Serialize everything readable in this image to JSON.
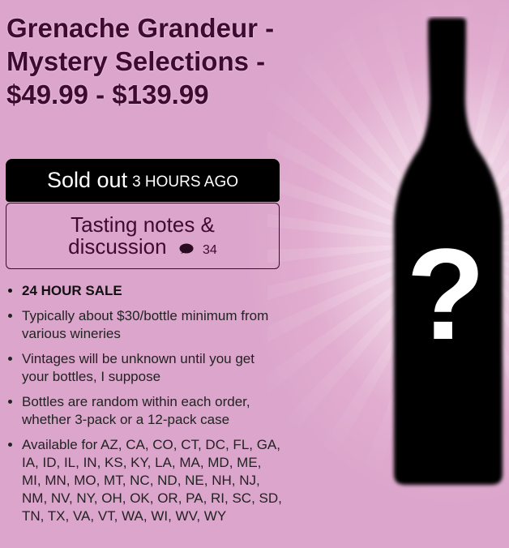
{
  "product": {
    "title": "Grenache Grandeur - Mystery Selections - $49.99 - $139.99"
  },
  "status": {
    "main": "Sold out",
    "time": "3 HOURS AGO"
  },
  "discussion": {
    "line1": "Tasting notes &",
    "line2": "discussion",
    "count": "34",
    "icon": "comment-bubble-icon"
  },
  "features": [
    "24 HOUR SALE",
    "Typically about $30/bottle minimum from various wineries",
    "Vintages will be unknown until you get your bottles, I suppose",
    "Bottles are random within each order, whether 3-pack or a 12-pack case",
    "Available for AZ, CA, CO, CT, DC, FL, GA, IA, ID, IL, IN, KS, KY, LA, MA, MD, ME, MI, MN, MO, MT, NC, ND, NE, NH, NJ, NM, NV, NY, OH, OK, OR, PA, RI, SC, SD, TN, TX, VA, VT, WA, WI, WV, WY"
  ],
  "image": {
    "glyph": "?",
    "icon": "mystery-wine-bottle-icon"
  },
  "colors": {
    "background": "#dca6cc",
    "title": "#3e0a30",
    "button": "#000000"
  }
}
